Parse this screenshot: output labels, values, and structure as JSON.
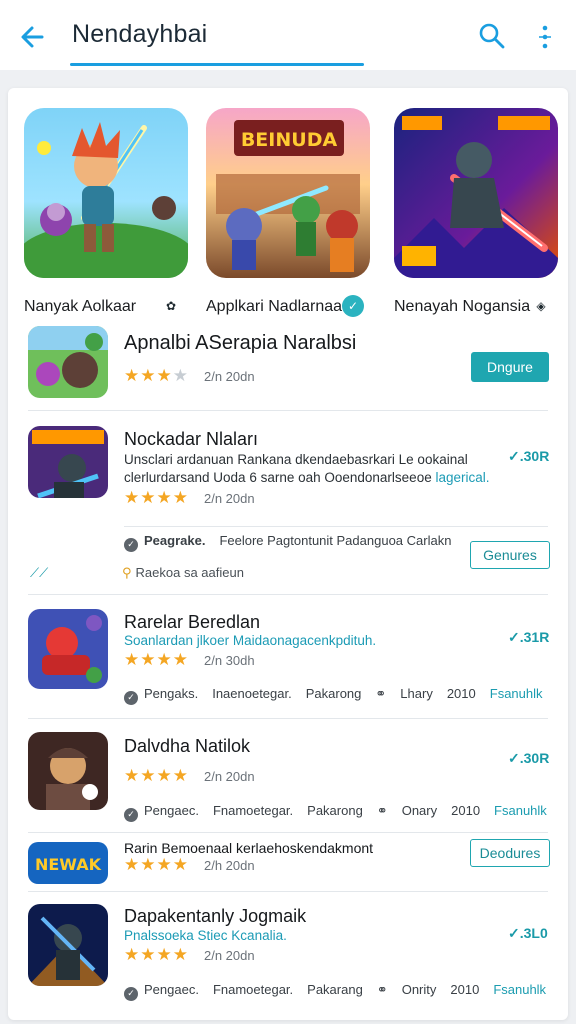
{
  "header": {
    "title": "Nendayhbai",
    "back_icon": "arrow-left-icon",
    "search_icon": "search-icon",
    "more_icon": "more-vertical-icon",
    "accent": "#1a9ee0"
  },
  "featured": [
    {
      "label": "Nanyak Aolkaar",
      "badge": "✿"
    },
    {
      "label": "Applkari Nadlarnaa",
      "art_title": "BEINUDA",
      "badge": "✓"
    },
    {
      "label": "Nenayah Nogansia",
      "badge": "◈"
    }
  ],
  "apps": [
    {
      "name": "Apnalbi ASerapia Naralbsi",
      "desc_1": "",
      "desc_2": "",
      "rating": 3,
      "count": "2/n 20dn",
      "button": "Dngure"
    },
    {
      "name": "Nockadar Nlaları",
      "desc_1": "Unsclari ardanuan Rankana dkendaebasrkari Le ookainal",
      "desc_2": "clerlurdarsand Uoda 6 sarne oah Ooendonarlseeoe",
      "desc_2_highlight": "lagerical.",
      "rating": 4,
      "count": "2/n 20dn",
      "price": "✓.30R",
      "meta_1": "Peagrake.",
      "meta_2": "Feelore Pagtontunit Padanguoa Carlakn",
      "secondary": "Raekoa sa aafieun",
      "button": "Genures"
    },
    {
      "name": "Rarelar Beredlan",
      "desc_1": "Soanlardan jlkoer Maidaonagacenkpdituh.",
      "rating": 4,
      "count": "2/n 30dh",
      "price": "✓.31R",
      "meta": [
        "Pengaks.",
        "Inaenoetegar.",
        "Pakarong",
        "Lhary",
        "2010",
        "Fsanuhlk"
      ]
    },
    {
      "name": "Dalvdha Natilok",
      "rating": 4,
      "count": "2/n 20dn",
      "price": "✓.30R",
      "meta": [
        "Pengaec.",
        "Fnamoetegar.",
        "Pakarong",
        "Onary",
        "2010",
        "Fsanuhlk"
      ]
    },
    {
      "name": "Rarin Bemoenaal kerlaehoskendakmont",
      "rating": 4,
      "count": "2/h 20dn",
      "button": "Deodures",
      "icon_text": "NEWAK"
    },
    {
      "name": "Dapakentanly Jogmaik",
      "desc_1": "Pnalssoeka Stiec Kcanalia.",
      "rating": 4,
      "count": "2/n 20dn",
      "price": "✓.3L0",
      "meta": [
        "Pengaec.",
        "Fnamoetegar.",
        "Pakarang",
        "Onrity",
        "2010",
        "Fsanuhlk"
      ]
    }
  ]
}
